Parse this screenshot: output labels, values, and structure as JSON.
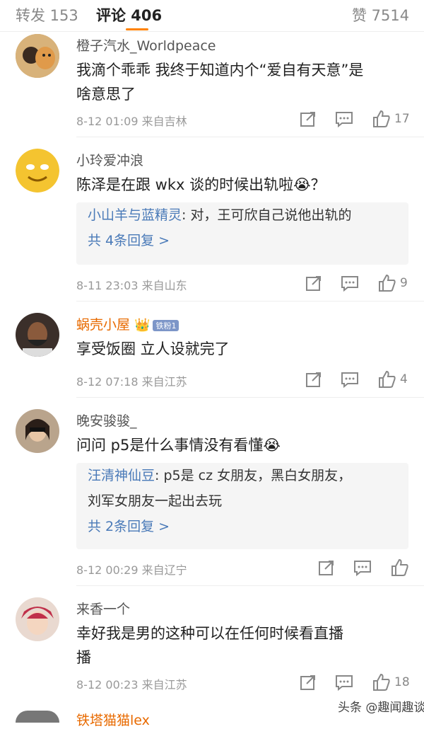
{
  "tabs": {
    "repost": "转发 153",
    "comments": "评论 406",
    "likes": "赞 7514"
  },
  "colors": {
    "accent": "#ff8200",
    "link": "#4a7ab8",
    "vip_name": "#e86a00"
  },
  "comments": [
    {
      "user": "橙子汽水_Worldpeace",
      "text1": "我滴个乖乖 我终于知道内个“爱自有天意”是",
      "text2": "啥意思了",
      "time": "8-12 01:09 来自吉林",
      "likes": "17"
    },
    {
      "user": "小玲爱冲浪",
      "text1": "陈泽是在跟 wkx 谈的时候出轨啦😭？",
      "reply_name": "小山羊与蓝精灵",
      "reply_text": ": 对，王可欣自己说他出轨的",
      "reply_more": "共 4条回复 >",
      "time": "8-11 23:03 来自山东",
      "likes": "9"
    },
    {
      "user": "蜗壳小屋",
      "badge": "铁粉1",
      "text1": "享受饭圈 立人设就完了",
      "time": "8-12 07:18 来自江苏",
      "likes": "4"
    },
    {
      "user": "晚安骏骏_",
      "text1": "问问 p5是什么事情没有看懂😭",
      "reply_name": "汪清神仙豆",
      "reply_text": ": p5是 cz 女朋友，黑白女朋友，",
      "reply_text2": "刘军女朋友一起出去玩",
      "reply_more": "共 2条回复 >",
      "time": "8-12 00:29 来自辽宁",
      "likes": ""
    },
    {
      "user": "来香一个",
      "text1": "幸好我是男的这种可以在任何时候看直播",
      "text2": "播",
      "time": "8-12 00:23 来自江苏",
      "likes": "18"
    }
  ],
  "footer_user": "铁塔猫猫lex",
  "watermark": "头条 @趣闻趣谈"
}
